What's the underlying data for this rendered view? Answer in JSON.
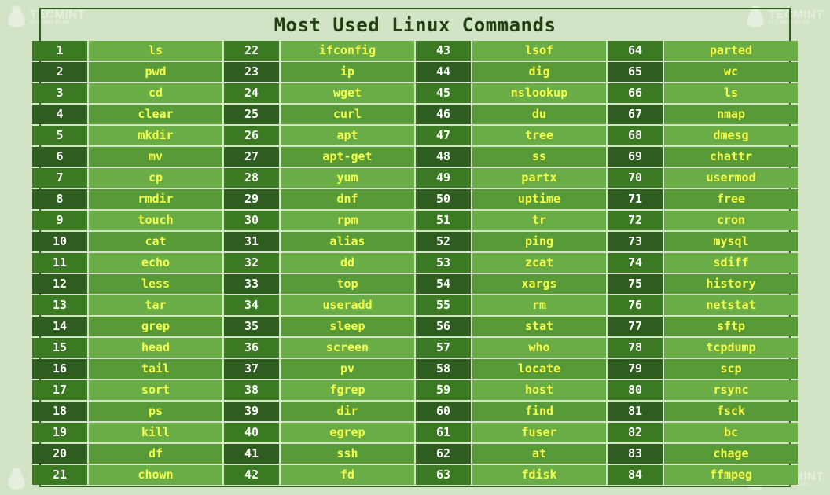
{
  "title": "Most Used Linux Commands",
  "brand_name": "TECMINT",
  "brand_tag": "#1 LINUX BLOG",
  "columns_per_group": 4,
  "rows": 21,
  "commands": [
    {
      "n": 1,
      "c": "ls"
    },
    {
      "n": 2,
      "c": "pwd"
    },
    {
      "n": 3,
      "c": "cd"
    },
    {
      "n": 4,
      "c": "clear"
    },
    {
      "n": 5,
      "c": "mkdir"
    },
    {
      "n": 6,
      "c": "mv"
    },
    {
      "n": 7,
      "c": "cp"
    },
    {
      "n": 8,
      "c": "rmdir"
    },
    {
      "n": 9,
      "c": "touch"
    },
    {
      "n": 10,
      "c": "cat"
    },
    {
      "n": 11,
      "c": "echo"
    },
    {
      "n": 12,
      "c": "less"
    },
    {
      "n": 13,
      "c": "tar"
    },
    {
      "n": 14,
      "c": "grep"
    },
    {
      "n": 15,
      "c": "head"
    },
    {
      "n": 16,
      "c": "tail"
    },
    {
      "n": 17,
      "c": "sort"
    },
    {
      "n": 18,
      "c": "ps"
    },
    {
      "n": 19,
      "c": "kill"
    },
    {
      "n": 20,
      "c": "df"
    },
    {
      "n": 21,
      "c": "chown"
    },
    {
      "n": 22,
      "c": "ifconfig"
    },
    {
      "n": 23,
      "c": "ip"
    },
    {
      "n": 24,
      "c": "wget"
    },
    {
      "n": 25,
      "c": "curl"
    },
    {
      "n": 26,
      "c": "apt"
    },
    {
      "n": 27,
      "c": "apt-get"
    },
    {
      "n": 28,
      "c": "yum"
    },
    {
      "n": 29,
      "c": "dnf"
    },
    {
      "n": 30,
      "c": "rpm"
    },
    {
      "n": 31,
      "c": "alias"
    },
    {
      "n": 32,
      "c": "dd"
    },
    {
      "n": 33,
      "c": "top"
    },
    {
      "n": 34,
      "c": "useradd"
    },
    {
      "n": 35,
      "c": "sleep"
    },
    {
      "n": 36,
      "c": "screen"
    },
    {
      "n": 37,
      "c": "pv"
    },
    {
      "n": 38,
      "c": "fgrep"
    },
    {
      "n": 39,
      "c": "dir"
    },
    {
      "n": 40,
      "c": "egrep"
    },
    {
      "n": 41,
      "c": "ssh"
    },
    {
      "n": 42,
      "c": "fd"
    },
    {
      "n": 43,
      "c": "lsof"
    },
    {
      "n": 44,
      "c": "dig"
    },
    {
      "n": 45,
      "c": "nslookup"
    },
    {
      "n": 46,
      "c": "du"
    },
    {
      "n": 47,
      "c": "tree"
    },
    {
      "n": 48,
      "c": "ss"
    },
    {
      "n": 49,
      "c": "partx"
    },
    {
      "n": 50,
      "c": "uptime"
    },
    {
      "n": 51,
      "c": "tr"
    },
    {
      "n": 52,
      "c": "ping"
    },
    {
      "n": 53,
      "c": "zcat"
    },
    {
      "n": 54,
      "c": "xargs"
    },
    {
      "n": 55,
      "c": "rm"
    },
    {
      "n": 56,
      "c": "stat"
    },
    {
      "n": 57,
      "c": "who"
    },
    {
      "n": 58,
      "c": "locate"
    },
    {
      "n": 59,
      "c": "host"
    },
    {
      "n": 60,
      "c": "find"
    },
    {
      "n": 61,
      "c": "fuser"
    },
    {
      "n": 62,
      "c": "at"
    },
    {
      "n": 63,
      "c": "fdisk"
    },
    {
      "n": 64,
      "c": "parted"
    },
    {
      "n": 65,
      "c": "wc"
    },
    {
      "n": 66,
      "c": "ls"
    },
    {
      "n": 67,
      "c": "nmap"
    },
    {
      "n": 68,
      "c": "dmesg"
    },
    {
      "n": 69,
      "c": "chattr"
    },
    {
      "n": 70,
      "c": "usermod"
    },
    {
      "n": 71,
      "c": "free"
    },
    {
      "n": 72,
      "c": "cron"
    },
    {
      "n": 73,
      "c": "mysql"
    },
    {
      "n": 74,
      "c": "sdiff"
    },
    {
      "n": 75,
      "c": "history"
    },
    {
      "n": 76,
      "c": "netstat"
    },
    {
      "n": 77,
      "c": "sftp"
    },
    {
      "n": 78,
      "c": "tcpdump"
    },
    {
      "n": 79,
      "c": "scp"
    },
    {
      "n": 80,
      "c": "rsync"
    },
    {
      "n": 81,
      "c": "fsck"
    },
    {
      "n": 82,
      "c": "bc"
    },
    {
      "n": 83,
      "c": "chage"
    },
    {
      "n": 84,
      "c": "ffmpeg"
    }
  ]
}
